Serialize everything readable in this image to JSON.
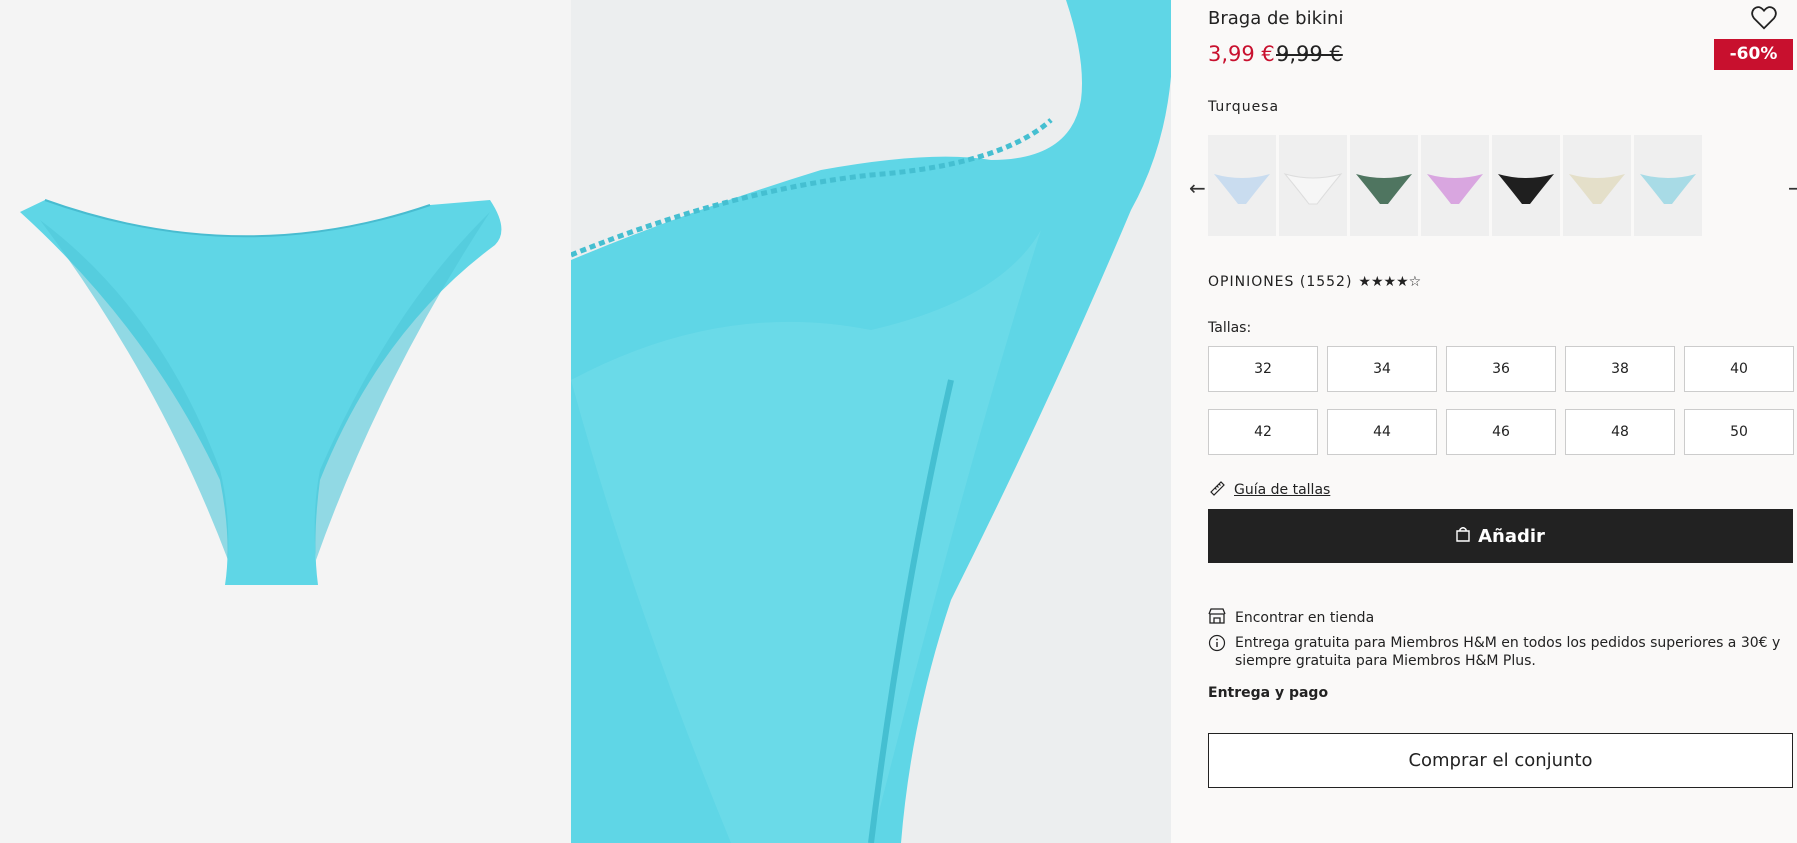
{
  "product": {
    "title": "Braga de bikini",
    "price": "3,99 €",
    "old_price": "9,99 €",
    "discount": "-60%",
    "color_name": "Turquesa"
  },
  "colors": {
    "accent_red": "#c8102e",
    "button_dark": "#222222",
    "turquoise": "#5fd6e6"
  },
  "swatches": [
    {
      "name": "blue-print",
      "color": "#c9dcef"
    },
    {
      "name": "white",
      "color": "#f3f3f3"
    },
    {
      "name": "green",
      "color": "#4f7560"
    },
    {
      "name": "lilac",
      "color": "#d9a6e0"
    },
    {
      "name": "black",
      "color": "#1f1f1f"
    },
    {
      "name": "beige",
      "color": "#e4dfc9"
    },
    {
      "name": "light-blue",
      "color": "#a8dbe6"
    }
  ],
  "reviews": {
    "label": "OPINIONES (1552)",
    "stars": "★★★★☆"
  },
  "sizes": {
    "label": "Tallas:",
    "options": [
      "32",
      "34",
      "36",
      "38",
      "40",
      "42",
      "44",
      "46",
      "48",
      "50"
    ]
  },
  "size_guide": "Guía de tallas",
  "add_button": "Añadir",
  "find_in_store": "Encontrar en tienda",
  "shipping_info": "Entrega gratuita para Miembros H&M en todos los pedidos superiores a 30€ y siempre gratuita para Miembros H&M Plus.",
  "delivery_link": "Entrega y pago",
  "buy_set_button": "Comprar el conjunto"
}
